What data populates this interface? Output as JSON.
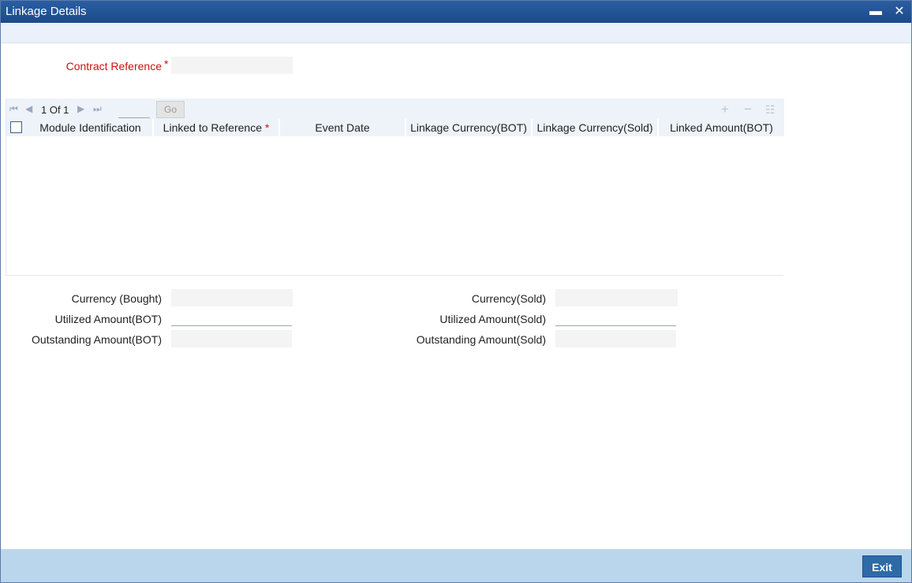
{
  "window": {
    "title": "Linkage Details",
    "minimize_icon": "minimize-icon",
    "close_icon": "close-icon",
    "minimize_glyph": "▬",
    "close_glyph": "✕"
  },
  "form": {
    "contract_reference": {
      "label": "Contract Reference",
      "required_mark": "*",
      "value": ""
    }
  },
  "grid": {
    "pagination": {
      "current": "1",
      "of_label": "Of",
      "total": "1",
      "text": "1 Of 1",
      "page_input": "",
      "go_label": "Go"
    },
    "nav_icons": [
      "first-page-icon",
      "prev-page-icon",
      "next-page-icon",
      "last-page-icon"
    ],
    "tool_icons": [
      "add-row-icon",
      "delete-row-icon",
      "single-view-icon"
    ],
    "columns": [
      {
        "label": "Module Identification"
      },
      {
        "label": "Linked to Reference",
        "required": "*"
      },
      {
        "label": "Event Date"
      },
      {
        "label": "Linkage Currency(BOT)"
      },
      {
        "label": "Linkage Currency(Sold)"
      },
      {
        "label": "Linked Amount(BOT)"
      }
    ],
    "rows": []
  },
  "summary": {
    "currency_bought": {
      "label": "Currency (Bought)",
      "value": ""
    },
    "utilized_amount_bot": {
      "label": "Utilized Amount(BOT)",
      "value": ""
    },
    "outstanding_amount_bot": {
      "label": "Outstanding Amount(BOT)",
      "value": ""
    },
    "currency_sold": {
      "label": "Currency(Sold)",
      "value": ""
    },
    "utilized_amount_sold": {
      "label": "Utilized Amount(Sold)",
      "value": ""
    },
    "outstanding_amount_sold": {
      "label": "Outstanding Amount(Sold)",
      "value": ""
    }
  },
  "footer": {
    "exit_label": "Exit"
  },
  "colors": {
    "title_bar": "#1c4a8a",
    "footer": "#bad6ec",
    "required": "#cc1111",
    "accent": "#2e6aa8"
  }
}
